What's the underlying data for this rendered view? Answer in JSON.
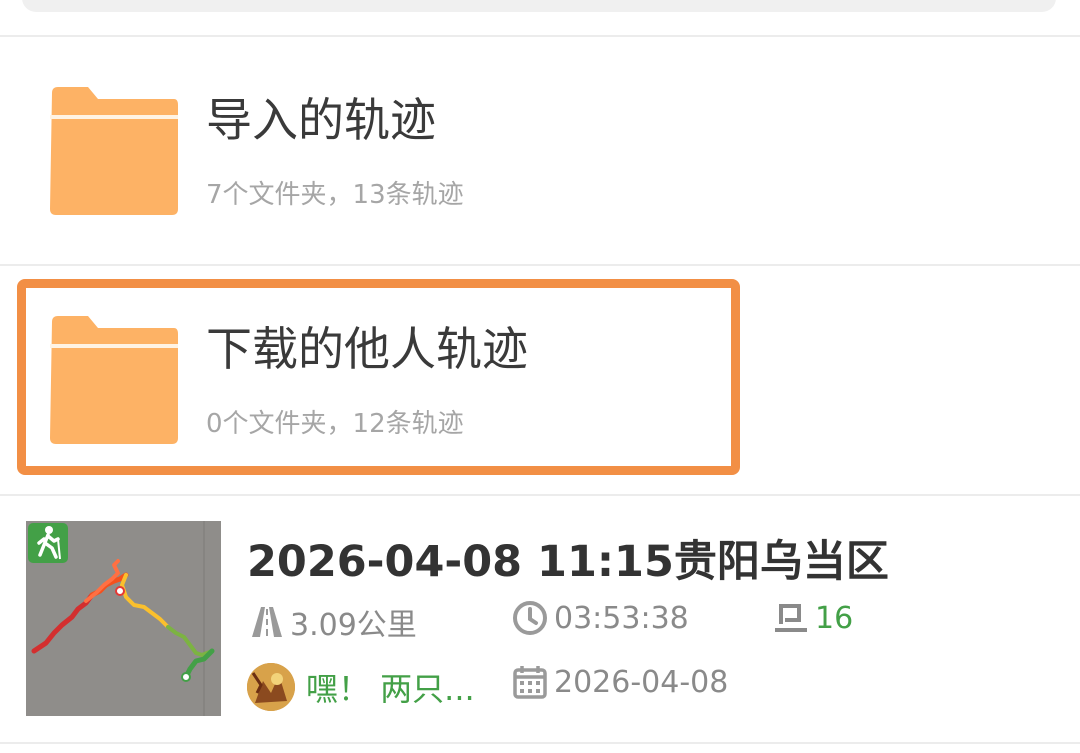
{
  "folders": [
    {
      "title": "导入的轨迹",
      "subtitle": "7个文件夹，13条轨迹"
    },
    {
      "title": "下载的他人轨迹",
      "subtitle": "0个文件夹，12条轨迹"
    }
  ],
  "track": {
    "title": "2026-04-08 11:15贵阳乌当区",
    "distance": "3.09公里",
    "duration": "03:53:38",
    "waypoints": "16",
    "author": "嘿！ 两只...",
    "date": "2026-04-08",
    "mode_icon": "hiking-icon"
  },
  "colors": {
    "folder": "#fdb265",
    "highlight": "#f28f45",
    "accent_green": "#43a047",
    "title_text": "#3a3a3a",
    "secondary_text": "#a6a6a6"
  }
}
